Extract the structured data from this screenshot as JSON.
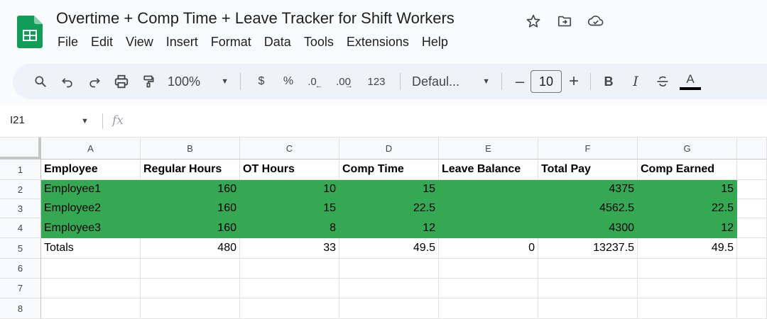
{
  "document": {
    "title": "Overtime + Comp Time + Leave Tracker for Shift Workers",
    "icons": [
      "star-icon",
      "move-to-folder-icon",
      "cloud-status-icon"
    ]
  },
  "menu": [
    "File",
    "Edit",
    "View",
    "Insert",
    "Format",
    "Data",
    "Tools",
    "Extensions",
    "Help"
  ],
  "toolbar": {
    "zoom": "100%",
    "currency": "$",
    "percent": "%",
    "decrease_decimal": ".0",
    "increase_decimal": ".00",
    "number_format": "123",
    "font": "Defaul...",
    "font_size_minus": "–",
    "font_size": "10",
    "font_size_plus": "+",
    "bold": "B",
    "italic": "I",
    "text_color": "A"
  },
  "formula_bar": {
    "cell_ref": "I21",
    "fx": "fx",
    "value": ""
  },
  "sheet": {
    "columns": [
      "A",
      "B",
      "C",
      "D",
      "E",
      "F",
      "G"
    ],
    "rows": [
      "1",
      "2",
      "3",
      "4",
      "5",
      "6",
      "7",
      "8"
    ],
    "header": [
      "Employee",
      "Regular Hours",
      "OT Hours",
      "Comp Time",
      "Leave Balance",
      "Total Pay",
      "Comp Earned"
    ],
    "data": [
      [
        "Employee1",
        "160",
        "10",
        "15",
        "",
        "4375",
        "15"
      ],
      [
        "Employee2",
        "160",
        "15",
        "22.5",
        "",
        "4562.5",
        "22.5"
      ],
      [
        "Employee3",
        "160",
        "8",
        "12",
        "",
        "4300",
        "12"
      ]
    ],
    "totals": [
      "Totals",
      "480",
      "33",
      "49.5",
      "0",
      "13237.5",
      "49.5"
    ],
    "highlight_color": "#34a853"
  }
}
